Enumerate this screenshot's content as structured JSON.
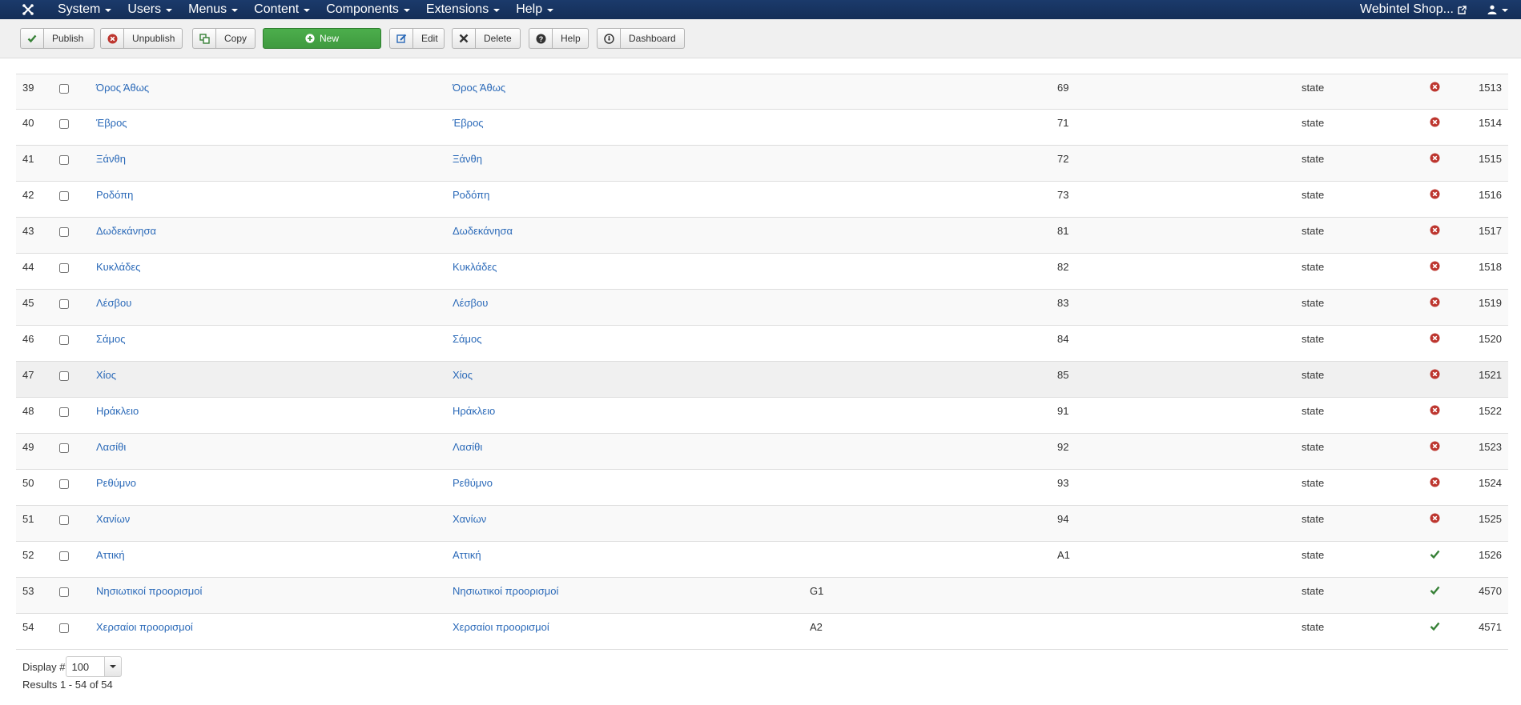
{
  "nav": {
    "menu": [
      "System",
      "Users",
      "Menus",
      "Content",
      "Components",
      "Extensions",
      "Help"
    ],
    "site_link": "Webintel Shop..."
  },
  "toolbar": {
    "publish": "Publish",
    "unpublish": "Unpublish",
    "copy": "Copy",
    "new": "New",
    "edit": "Edit",
    "delete": "Delete",
    "help": "Help",
    "dashboard": "Dashboard"
  },
  "colors": {
    "navbar": "#1a3867",
    "link": "#2a69b8",
    "new_button": "#46a546",
    "status_unpublished": "#bd362f",
    "status_published": "#378137"
  },
  "rows": [
    {
      "num": "39",
      "name": "Όρος Άθως",
      "name2": "Όρος Άθως",
      "code2": "",
      "code3": "69",
      "type": "state",
      "status": "unpublished",
      "id": "1513"
    },
    {
      "num": "40",
      "name": "Έβρος",
      "name2": "Έβρος",
      "code2": "",
      "code3": "71",
      "type": "state",
      "status": "unpublished",
      "id": "1514"
    },
    {
      "num": "41",
      "name": "Ξάνθη",
      "name2": "Ξάνθη",
      "code2": "",
      "code3": "72",
      "type": "state",
      "status": "unpublished",
      "id": "1515"
    },
    {
      "num": "42",
      "name": "Ροδόπη",
      "name2": "Ροδόπη",
      "code2": "",
      "code3": "73",
      "type": "state",
      "status": "unpublished",
      "id": "1516"
    },
    {
      "num": "43",
      "name": "Δωδεκάνησα",
      "name2": "Δωδεκάνησα",
      "code2": "",
      "code3": "81",
      "type": "state",
      "status": "unpublished",
      "id": "1517"
    },
    {
      "num": "44",
      "name": "Κυκλάδες",
      "name2": "Κυκλάδες",
      "code2": "",
      "code3": "82",
      "type": "state",
      "status": "unpublished",
      "id": "1518"
    },
    {
      "num": "45",
      "name": "Λέσβου",
      "name2": "Λέσβου",
      "code2": "",
      "code3": "83",
      "type": "state",
      "status": "unpublished",
      "id": "1519"
    },
    {
      "num": "46",
      "name": "Σάμος",
      "name2": "Σάμος",
      "code2": "",
      "code3": "84",
      "type": "state",
      "status": "unpublished",
      "id": "1520"
    },
    {
      "num": "47",
      "name": "Χίος",
      "name2": "Χίος",
      "code2": "",
      "code3": "85",
      "type": "state",
      "status": "unpublished",
      "id": "1521"
    },
    {
      "num": "48",
      "name": "Ηράκλειο",
      "name2": "Ηράκλειο",
      "code2": "",
      "code3": "91",
      "type": "state",
      "status": "unpublished",
      "id": "1522"
    },
    {
      "num": "49",
      "name": "Λασίθι",
      "name2": "Λασίθι",
      "code2": "",
      "code3": "92",
      "type": "state",
      "status": "unpublished",
      "id": "1523"
    },
    {
      "num": "50",
      "name": "Ρεθύμνο",
      "name2": "Ρεθύμνο",
      "code2": "",
      "code3": "93",
      "type": "state",
      "status": "unpublished",
      "id": "1524"
    },
    {
      "num": "51",
      "name": "Χανίων",
      "name2": "Χανίων",
      "code2": "",
      "code3": "94",
      "type": "state",
      "status": "unpublished",
      "id": "1525"
    },
    {
      "num": "52",
      "name": "Αττική",
      "name2": "Αττική",
      "code2": "",
      "code3": "A1",
      "type": "state",
      "status": "published",
      "id": "1526"
    },
    {
      "num": "53",
      "name": "Νησιωτικοί προορισμοί",
      "name2": "Νησιωτικοί προορισμοί",
      "code2": "G1",
      "code3": "",
      "type": "state",
      "status": "published",
      "id": "4570"
    },
    {
      "num": "54",
      "name": "Χερσαίοι προορισμοί",
      "name2": "Χερσαίοι προορισμοί",
      "code2": "A2",
      "code3": "",
      "type": "state",
      "status": "published",
      "id": "4571"
    }
  ],
  "footer": {
    "display_label": "Display #",
    "limit_value": "100",
    "results": "Results 1 - 54 of 54"
  }
}
